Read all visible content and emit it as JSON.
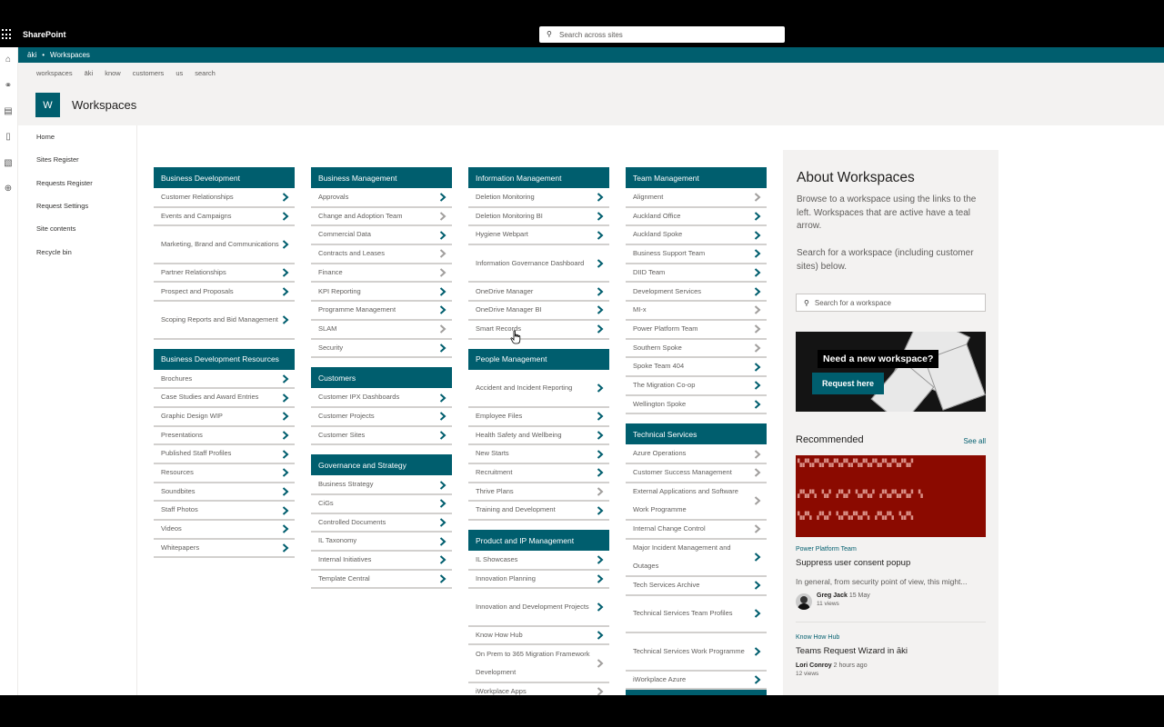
{
  "app": {
    "name": "SharePoint",
    "search_placeholder": "Search across sites"
  },
  "hub": {
    "site": "āki",
    "separator": "•",
    "current": "Workspaces"
  },
  "site_nav": [
    "workspaces",
    "āki",
    "know",
    "customers",
    "us",
    "search"
  ],
  "site": {
    "logo_letter": "W",
    "title": "Workspaces"
  },
  "left_nav": [
    "Home",
    "Sites Register",
    "Requests Register",
    "Request Settings",
    "Site contents",
    "Recycle bin"
  ],
  "colors": {
    "accent": "#005e6e",
    "active_arrow": "#005e6e",
    "inactive_arrow": "#a19f9d"
  },
  "columns": [
    [
      {
        "title": "Business Development",
        "items": [
          {
            "label": "Customer Relationships",
            "active": true
          },
          {
            "label": "Events and Campaigns",
            "active": true
          },
          {
            "label": "Marketing, Brand and Communications",
            "active": true
          },
          {
            "label": "Partner Relationships",
            "active": true
          },
          {
            "label": "Prospect and Proposals",
            "active": true
          },
          {
            "label": "Scoping Reports and Bid Management",
            "active": true
          }
        ]
      },
      {
        "title": "Business Development Resources",
        "items": [
          {
            "label": "Brochures",
            "active": true
          },
          {
            "label": "Case Studies and Award Entries",
            "active": true
          },
          {
            "label": "Graphic Design WIP",
            "active": true
          },
          {
            "label": "Presentations",
            "active": true
          },
          {
            "label": "Published Staff Profiles",
            "active": true
          },
          {
            "label": "Resources",
            "active": true
          },
          {
            "label": "Soundbites",
            "active": true
          },
          {
            "label": "Staff Photos",
            "active": true
          },
          {
            "label": "Videos",
            "active": true
          },
          {
            "label": "Whitepapers",
            "active": true
          }
        ]
      }
    ],
    [
      {
        "title": "Business Management",
        "items": [
          {
            "label": "Approvals",
            "active": true
          },
          {
            "label": "Change and Adoption Team",
            "active": false
          },
          {
            "label": "Commercial Data",
            "active": true
          },
          {
            "label": "Contracts and Leases",
            "active": false
          },
          {
            "label": "Finance",
            "active": false
          },
          {
            "label": "KPI Reporting",
            "active": true
          },
          {
            "label": "Programme Management",
            "active": true
          },
          {
            "label": "SLAM",
            "active": false
          },
          {
            "label": "Security",
            "active": true
          }
        ]
      },
      {
        "title": "Customers",
        "items": [
          {
            "label": "Customer IPX Dashboards",
            "active": true
          },
          {
            "label": "Customer Projects",
            "active": true
          },
          {
            "label": "Customer Sites",
            "active": true
          }
        ]
      },
      {
        "title": "Governance and Strategy",
        "items": [
          {
            "label": "Business Strategy",
            "active": true
          },
          {
            "label": "CiGs",
            "active": true
          },
          {
            "label": "Controlled Documents",
            "active": true
          },
          {
            "label": "IL Taxonomy",
            "active": true
          },
          {
            "label": "Internal Initiatives",
            "active": true
          },
          {
            "label": "Template Central",
            "active": true
          }
        ]
      }
    ],
    [
      {
        "title": "Information Management",
        "items": [
          {
            "label": "Deletion Monitoring",
            "active": true
          },
          {
            "label": "Deletion Monitoring BI",
            "active": true
          },
          {
            "label": "Hygiene Webpart",
            "active": true
          },
          {
            "label": "Information Governance Dashboard",
            "active": true
          },
          {
            "label": "OneDrive Manager",
            "active": true
          },
          {
            "label": "OneDrive Manager BI",
            "active": true
          },
          {
            "label": "Smart Records",
            "active": true
          }
        ]
      },
      {
        "title": "People Management",
        "items": [
          {
            "label": "Accident and Incident Reporting",
            "active": true
          },
          {
            "label": "Employee Files",
            "active": true
          },
          {
            "label": "Health Safety and Wellbeing",
            "active": true
          },
          {
            "label": "New Starts",
            "active": true
          },
          {
            "label": "Recruitment",
            "active": true
          },
          {
            "label": "Thrive Plans",
            "active": false
          },
          {
            "label": "Training and Development",
            "active": true
          }
        ]
      },
      {
        "title": "Product and IP Management",
        "items": [
          {
            "label": "IL Showcases",
            "active": true
          },
          {
            "label": "Innovation Planning",
            "active": true
          },
          {
            "label": "Innovation and Development Projects",
            "active": true
          },
          {
            "label": "Know How Hub",
            "active": true
          },
          {
            "label": "On Prem to 365 Migration Framework Development",
            "active": false
          },
          {
            "label": "iWorkplace Apps",
            "active": false
          }
        ]
      }
    ],
    [
      {
        "title": "Team Management",
        "items": [
          {
            "label": "Alignment",
            "active": false
          },
          {
            "label": "Auckland Office",
            "active": true
          },
          {
            "label": "Auckland Spoke",
            "active": true
          },
          {
            "label": "Business Support Team",
            "active": true
          },
          {
            "label": "DIID Team",
            "active": true
          },
          {
            "label": "Development Services",
            "active": true
          },
          {
            "label": "MI-x",
            "active": false
          },
          {
            "label": "Power Platform Team",
            "active": false
          },
          {
            "label": "Southern Spoke",
            "active": false
          },
          {
            "label": "Spoke Team 404",
            "active": true
          },
          {
            "label": "The Migration Co-op",
            "active": true
          },
          {
            "label": "Wellington Spoke",
            "active": true
          }
        ]
      },
      {
        "title": "Technical Services",
        "items": [
          {
            "label": "Azure Operations",
            "active": false
          },
          {
            "label": "Customer Success Management",
            "active": false
          },
          {
            "label": "External Applications and Software Work Programme",
            "active": false
          },
          {
            "label": "Internal Change Control",
            "active": false
          },
          {
            "label": "Major Incident Management and Outages",
            "active": true
          },
          {
            "label": "Tech Services Archive",
            "active": true
          },
          {
            "label": "Technical Services Team Profiles",
            "active": true
          },
          {
            "label": "Technical Services Work Programme",
            "active": true
          },
          {
            "label": "iWorkplace Azure",
            "active": true
          }
        ]
      }
    ]
  ],
  "about": {
    "title": "About Workspaces",
    "p1": "Browse to a workspace using the links to the left. Workspaces that are active have a teal arrow.",
    "p2": "Search for a workspace (including customer sites) below.",
    "search_placeholder": "Search for a workspace",
    "banner_title": "Need a new workspace?",
    "banner_button": "Request here"
  },
  "recommended": {
    "title": "Recommended",
    "see_all": "See all",
    "cards": [
      {
        "site": "Power Platform Team",
        "title": "Suppress user consent popup",
        "desc": "In general, from security point of view, this might...",
        "author": "Greg Jack",
        "date": "15 May",
        "views": "11 views"
      },
      {
        "site": "Know How Hub",
        "title": "Teams Request Wizard in āki",
        "author": "Lori Conroy",
        "date": "2 hours ago",
        "views": "12 views"
      }
    ]
  }
}
